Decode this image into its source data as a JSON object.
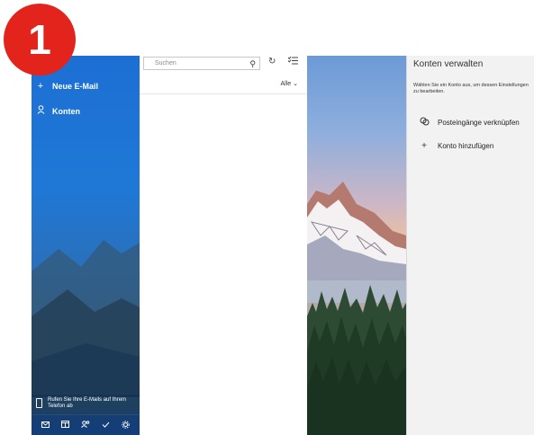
{
  "badge": {
    "number": "1"
  },
  "sidebar": {
    "new_mail": {
      "icon": "plus-icon",
      "label": "Neue E-Mail"
    },
    "accounts": {
      "icon": "person-icon",
      "label": "Konten"
    },
    "phone_promo": {
      "icon": "phone-icon",
      "text": "Rufen Sie Ihre E-Mails auf Ihrem Telefon ab"
    },
    "bottom_icons": [
      "mail-icon",
      "calendar-icon",
      "people-icon",
      "todo-icon",
      "settings-icon"
    ]
  },
  "list": {
    "search_placeholder": "Suchen",
    "filter": {
      "label": "Alle",
      "chevron": "chevron-down-icon"
    }
  },
  "account_panel": {
    "title": "Konten verwalten",
    "description": "Wählen Sie ein Konto aus, um dessen Einstellungen zu bearbeiten.",
    "link_inboxes": {
      "icon": "link-icon",
      "label": "Posteingänge verknüpfen"
    },
    "add_account": {
      "icon": "plus-icon",
      "label": "Konto hinzufügen"
    }
  },
  "colors": {
    "badge": "#e2241c",
    "sidebar_blue": "#1f78d6",
    "panel_bg": "#f2f2f2"
  }
}
